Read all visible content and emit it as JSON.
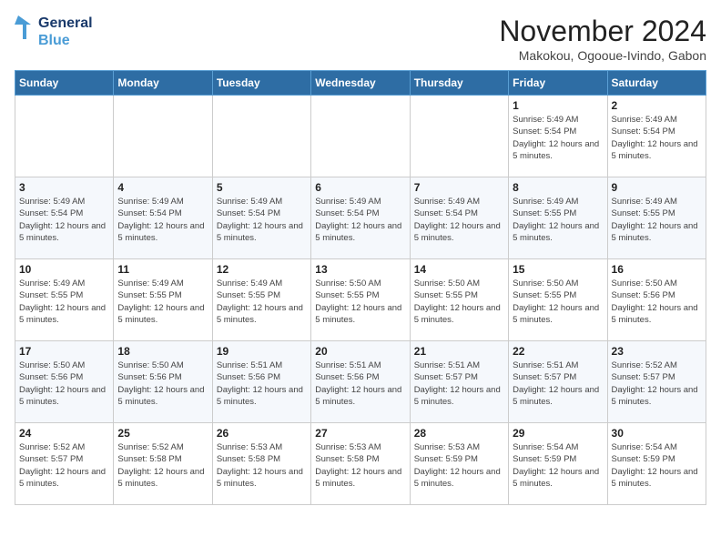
{
  "logo": {
    "line1": "General",
    "line2": "Blue"
  },
  "title": "November 2024",
  "location": "Makokou, Ogooue-Ivindo, Gabon",
  "weekdays": [
    "Sunday",
    "Monday",
    "Tuesday",
    "Wednesday",
    "Thursday",
    "Friday",
    "Saturday"
  ],
  "weeks": [
    [
      {
        "day": "",
        "info": ""
      },
      {
        "day": "",
        "info": ""
      },
      {
        "day": "",
        "info": ""
      },
      {
        "day": "",
        "info": ""
      },
      {
        "day": "",
        "info": ""
      },
      {
        "day": "1",
        "info": "Sunrise: 5:49 AM\nSunset: 5:54 PM\nDaylight: 12 hours and 5 minutes."
      },
      {
        "day": "2",
        "info": "Sunrise: 5:49 AM\nSunset: 5:54 PM\nDaylight: 12 hours and 5 minutes."
      }
    ],
    [
      {
        "day": "3",
        "info": "Sunrise: 5:49 AM\nSunset: 5:54 PM\nDaylight: 12 hours and 5 minutes."
      },
      {
        "day": "4",
        "info": "Sunrise: 5:49 AM\nSunset: 5:54 PM\nDaylight: 12 hours and 5 minutes."
      },
      {
        "day": "5",
        "info": "Sunrise: 5:49 AM\nSunset: 5:54 PM\nDaylight: 12 hours and 5 minutes."
      },
      {
        "day": "6",
        "info": "Sunrise: 5:49 AM\nSunset: 5:54 PM\nDaylight: 12 hours and 5 minutes."
      },
      {
        "day": "7",
        "info": "Sunrise: 5:49 AM\nSunset: 5:54 PM\nDaylight: 12 hours and 5 minutes."
      },
      {
        "day": "8",
        "info": "Sunrise: 5:49 AM\nSunset: 5:55 PM\nDaylight: 12 hours and 5 minutes."
      },
      {
        "day": "9",
        "info": "Sunrise: 5:49 AM\nSunset: 5:55 PM\nDaylight: 12 hours and 5 minutes."
      }
    ],
    [
      {
        "day": "10",
        "info": "Sunrise: 5:49 AM\nSunset: 5:55 PM\nDaylight: 12 hours and 5 minutes."
      },
      {
        "day": "11",
        "info": "Sunrise: 5:49 AM\nSunset: 5:55 PM\nDaylight: 12 hours and 5 minutes."
      },
      {
        "day": "12",
        "info": "Sunrise: 5:49 AM\nSunset: 5:55 PM\nDaylight: 12 hours and 5 minutes."
      },
      {
        "day": "13",
        "info": "Sunrise: 5:50 AM\nSunset: 5:55 PM\nDaylight: 12 hours and 5 minutes."
      },
      {
        "day": "14",
        "info": "Sunrise: 5:50 AM\nSunset: 5:55 PM\nDaylight: 12 hours and 5 minutes."
      },
      {
        "day": "15",
        "info": "Sunrise: 5:50 AM\nSunset: 5:55 PM\nDaylight: 12 hours and 5 minutes."
      },
      {
        "day": "16",
        "info": "Sunrise: 5:50 AM\nSunset: 5:56 PM\nDaylight: 12 hours and 5 minutes."
      }
    ],
    [
      {
        "day": "17",
        "info": "Sunrise: 5:50 AM\nSunset: 5:56 PM\nDaylight: 12 hours and 5 minutes."
      },
      {
        "day": "18",
        "info": "Sunrise: 5:50 AM\nSunset: 5:56 PM\nDaylight: 12 hours and 5 minutes."
      },
      {
        "day": "19",
        "info": "Sunrise: 5:51 AM\nSunset: 5:56 PM\nDaylight: 12 hours and 5 minutes."
      },
      {
        "day": "20",
        "info": "Sunrise: 5:51 AM\nSunset: 5:56 PM\nDaylight: 12 hours and 5 minutes."
      },
      {
        "day": "21",
        "info": "Sunrise: 5:51 AM\nSunset: 5:57 PM\nDaylight: 12 hours and 5 minutes."
      },
      {
        "day": "22",
        "info": "Sunrise: 5:51 AM\nSunset: 5:57 PM\nDaylight: 12 hours and 5 minutes."
      },
      {
        "day": "23",
        "info": "Sunrise: 5:52 AM\nSunset: 5:57 PM\nDaylight: 12 hours and 5 minutes."
      }
    ],
    [
      {
        "day": "24",
        "info": "Sunrise: 5:52 AM\nSunset: 5:57 PM\nDaylight: 12 hours and 5 minutes."
      },
      {
        "day": "25",
        "info": "Sunrise: 5:52 AM\nSunset: 5:58 PM\nDaylight: 12 hours and 5 minutes."
      },
      {
        "day": "26",
        "info": "Sunrise: 5:53 AM\nSunset: 5:58 PM\nDaylight: 12 hours and 5 minutes."
      },
      {
        "day": "27",
        "info": "Sunrise: 5:53 AM\nSunset: 5:58 PM\nDaylight: 12 hours and 5 minutes."
      },
      {
        "day": "28",
        "info": "Sunrise: 5:53 AM\nSunset: 5:59 PM\nDaylight: 12 hours and 5 minutes."
      },
      {
        "day": "29",
        "info": "Sunrise: 5:54 AM\nSunset: 5:59 PM\nDaylight: 12 hours and 5 minutes."
      },
      {
        "day": "30",
        "info": "Sunrise: 5:54 AM\nSunset: 5:59 PM\nDaylight: 12 hours and 5 minutes."
      }
    ]
  ]
}
